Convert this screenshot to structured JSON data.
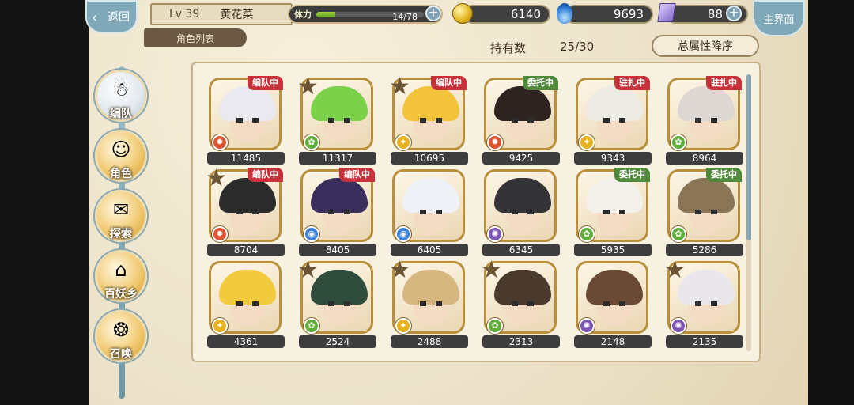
{
  "header": {
    "back_label": "返回",
    "level": "Lv 39",
    "player_name": "黄花菜",
    "tab_label": "角色列表",
    "stamina_label": "体力",
    "stamina_text": "14/78",
    "stamina_fraction": 0.18,
    "gold": "6140",
    "blue": "9693",
    "gems": "88",
    "home_label": "主界面"
  },
  "toolbar": {
    "own_label": "持有数",
    "own_value": "25/30",
    "sort_label": "总属性降序"
  },
  "menu": [
    {
      "label": "编队",
      "icon": "team-icon",
      "active": true
    },
    {
      "label": "角色",
      "icon": "character-icon",
      "active": false
    },
    {
      "label": "探索",
      "icon": "explore-icon",
      "active": false
    },
    {
      "label": "百妖乡",
      "icon": "village-icon",
      "active": false
    },
    {
      "label": "召唤",
      "icon": "summon-icon",
      "active": false
    }
  ],
  "characters": [
    {
      "power": "11485",
      "badge": "编队中",
      "badge_color": "red",
      "star": false,
      "element": "fire",
      "hair": "#e9e9ef"
    },
    {
      "power": "11317",
      "badge": "",
      "badge_color": "",
      "star": true,
      "element": "wind",
      "hair": "#7cd14a"
    },
    {
      "power": "10695",
      "badge": "编队中",
      "badge_color": "red",
      "star": true,
      "element": "light",
      "hair": "#f3c33b"
    },
    {
      "power": "9425",
      "badge": "委托中",
      "badge_color": "green",
      "star": false,
      "element": "fire",
      "hair": "#2d2420"
    },
    {
      "power": "9343",
      "badge": "驻扎中",
      "badge_color": "red",
      "star": false,
      "element": "light",
      "hair": "#ecebe4"
    },
    {
      "power": "8964",
      "badge": "驻扎中",
      "badge_color": "red",
      "star": false,
      "element": "wind",
      "hair": "#dcd7d2"
    },
    {
      "power": "8704",
      "badge": "编队中",
      "badge_color": "red",
      "star": true,
      "element": "fire",
      "hair": "#2b2b2b"
    },
    {
      "power": "8405",
      "badge": "编队中",
      "badge_color": "red",
      "star": false,
      "element": "water",
      "hair": "#3a2f5c"
    },
    {
      "power": "6405",
      "badge": "",
      "badge_color": "",
      "star": false,
      "element": "water",
      "hair": "#eef1f5"
    },
    {
      "power": "6345",
      "badge": "",
      "badge_color": "",
      "star": false,
      "element": "dark",
      "hair": "#333338"
    },
    {
      "power": "5935",
      "badge": "委托中",
      "badge_color": "green",
      "star": false,
      "element": "wind",
      "hair": "#f1f1ea"
    },
    {
      "power": "5286",
      "badge": "委托中",
      "badge_color": "green",
      "star": false,
      "element": "wind",
      "hair": "#8a7556"
    },
    {
      "power": "4361",
      "badge": "",
      "badge_color": "",
      "star": false,
      "element": "light",
      "hair": "#f1cb3d"
    },
    {
      "power": "2524",
      "badge": "",
      "badge_color": "",
      "star": true,
      "element": "wind",
      "hair": "#2f4c3c"
    },
    {
      "power": "2488",
      "badge": "",
      "badge_color": "",
      "star": true,
      "element": "light",
      "hair": "#d7b780"
    },
    {
      "power": "2313",
      "badge": "",
      "badge_color": "",
      "star": true,
      "element": "wind",
      "hair": "#4a3a2e"
    },
    {
      "power": "2148",
      "badge": "",
      "badge_color": "",
      "star": false,
      "element": "dark",
      "hair": "#6a4a34"
    },
    {
      "power": "2135",
      "badge": "",
      "badge_color": "",
      "star": true,
      "element": "dark",
      "hair": "#e9e7ec"
    }
  ],
  "colors": {
    "fire": "#e0512d",
    "wind": "#5fae3a",
    "light": "#e6b21f",
    "water": "#3c82d8",
    "dark": "#7c54b3"
  }
}
